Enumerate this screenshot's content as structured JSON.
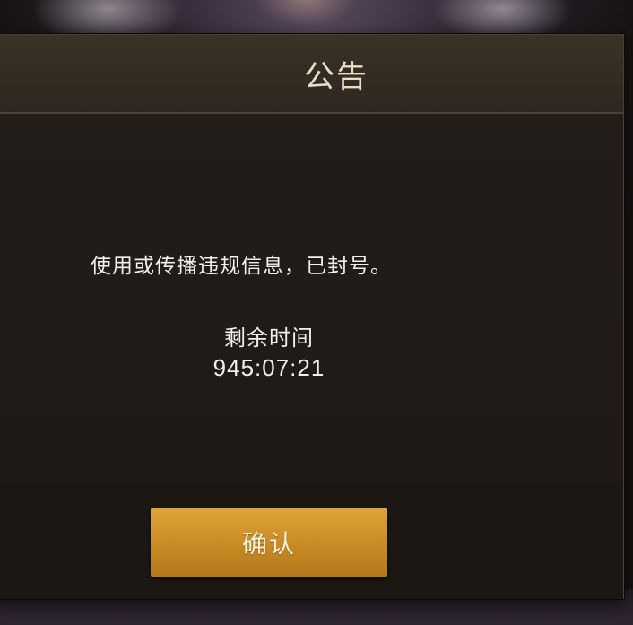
{
  "dialog": {
    "title": "公告",
    "message": "使用或传播违规信息，已封号。",
    "remaining_label": "剩余时间",
    "countdown": "945:07:21",
    "confirm_label": "确认"
  },
  "colors": {
    "button": "#c88a24",
    "title_text": "#e8dcc4",
    "panel": "#1e1a16"
  }
}
